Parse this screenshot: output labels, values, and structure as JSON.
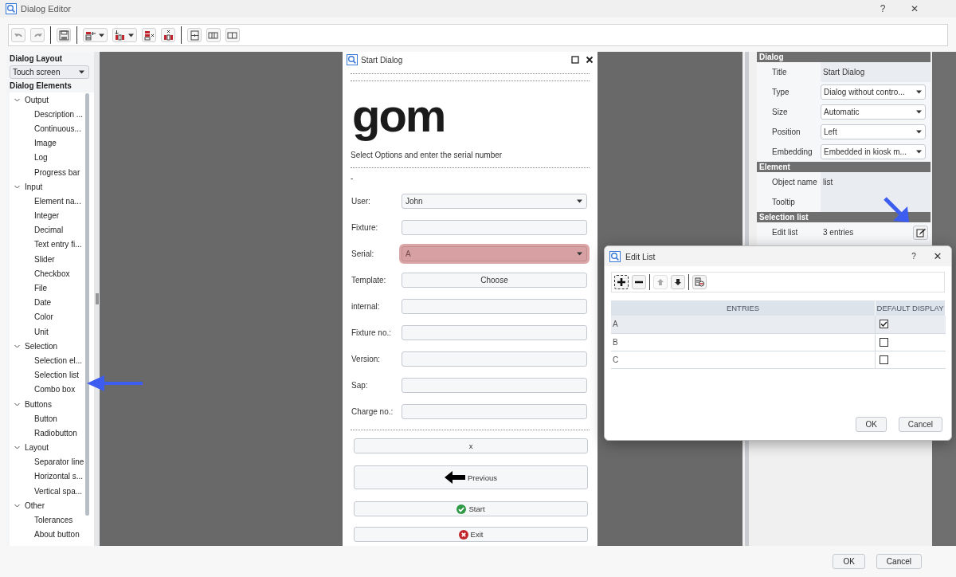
{
  "window": {
    "title": "Dialog Editor",
    "help": "?",
    "close": "✕"
  },
  "left_panel": {
    "layout_heading": "Dialog Layout",
    "layout_value": "Touch screen",
    "elements_heading": "Dialog Elements",
    "tree": [
      {
        "label": "Output",
        "expanded": true,
        "children": [
          {
            "label": "Description ..."
          },
          {
            "label": "Continuous..."
          },
          {
            "label": "Image"
          },
          {
            "label": "Log"
          },
          {
            "label": "Progress bar"
          }
        ]
      },
      {
        "label": "Input",
        "expanded": true,
        "children": [
          {
            "label": "Element na..."
          },
          {
            "label": "Integer"
          },
          {
            "label": "Decimal"
          },
          {
            "label": "Text entry fi..."
          },
          {
            "label": "Slider"
          },
          {
            "label": "Checkbox"
          },
          {
            "label": "File"
          },
          {
            "label": "Date"
          },
          {
            "label": "Color"
          },
          {
            "label": "Unit"
          }
        ]
      },
      {
        "label": "Selection",
        "expanded": true,
        "children": [
          {
            "label": "Selection el..."
          },
          {
            "label": "Selection list"
          },
          {
            "label": "Combo box"
          }
        ]
      },
      {
        "label": "Buttons",
        "expanded": true,
        "children": [
          {
            "label": "Button"
          },
          {
            "label": "Radiobutton"
          }
        ]
      },
      {
        "label": "Layout",
        "expanded": true,
        "children": [
          {
            "label": "Separator line"
          },
          {
            "label": "Horizontal s..."
          },
          {
            "label": "Vertical spa..."
          }
        ]
      },
      {
        "label": "Other",
        "expanded": true,
        "children": [
          {
            "label": "Tolerances"
          },
          {
            "label": "About button"
          }
        ]
      }
    ]
  },
  "preview": {
    "title": "Start Dialog",
    "logo": "gom",
    "description": "Select Options and enter the serial number",
    "dash": "-",
    "fields": [
      {
        "label": "User:",
        "kind": "combo",
        "value": "John",
        "error": false
      },
      {
        "label": "Fixture:",
        "kind": "text",
        "error": false
      },
      {
        "label": "Serial:",
        "kind": "combo",
        "value": "A",
        "error": true
      },
      {
        "label": "Template:",
        "kind": "button",
        "value": "Choose",
        "error": false
      },
      {
        "label": "internal:",
        "kind": "text",
        "error": false
      },
      {
        "label": "Fixture no.:",
        "kind": "text",
        "error": false
      },
      {
        "label": "Version:",
        "kind": "text",
        "error": false
      },
      {
        "label": "Sap:",
        "kind": "text",
        "error": false
      },
      {
        "label": "Charge no.:",
        "kind": "text",
        "error": false
      }
    ],
    "buttons": [
      {
        "label": "x",
        "kind": "plain"
      },
      {
        "label": "Previous",
        "kind": "back"
      },
      {
        "label": "Start",
        "kind": "confirm"
      },
      {
        "label": "Exit",
        "kind": "cancel"
      }
    ]
  },
  "properties": {
    "sections": [
      {
        "title": "Dialog",
        "rows": [
          {
            "label": "Title",
            "kind": "text",
            "value": "Start Dialog"
          },
          {
            "label": "Type",
            "kind": "dropdown",
            "value": "Dialog without contro..."
          },
          {
            "label": "Size",
            "kind": "dropdown",
            "value": "Automatic"
          },
          {
            "label": "Position",
            "kind": "dropdown",
            "value": "Left"
          },
          {
            "label": "Embedding",
            "kind": "dropdown",
            "value": "Embedded in kiosk m..."
          }
        ]
      },
      {
        "title": "Element",
        "rows": [
          {
            "label": "Object name",
            "kind": "text",
            "value": "list"
          },
          {
            "label": "Tooltip",
            "kind": "text"
          }
        ]
      },
      {
        "title": "Selection list",
        "rows": [
          {
            "label": "Edit list",
            "kind": "edit",
            "value": "3 entries"
          }
        ]
      }
    ]
  },
  "edit_list": {
    "title": "Edit List",
    "help": "?",
    "close": "✕",
    "columns": [
      "ENTRIES",
      "DEFAULT DISPLAY"
    ],
    "rows": [
      {
        "entry": "A",
        "checked": true,
        "selected": true
      },
      {
        "entry": "B",
        "checked": false,
        "selected": false
      },
      {
        "entry": "C",
        "checked": false,
        "selected": false
      }
    ],
    "buttons": [
      "OK",
      "Cancel"
    ]
  },
  "footer": {
    "buttons": [
      "OK",
      "Cancel"
    ]
  }
}
